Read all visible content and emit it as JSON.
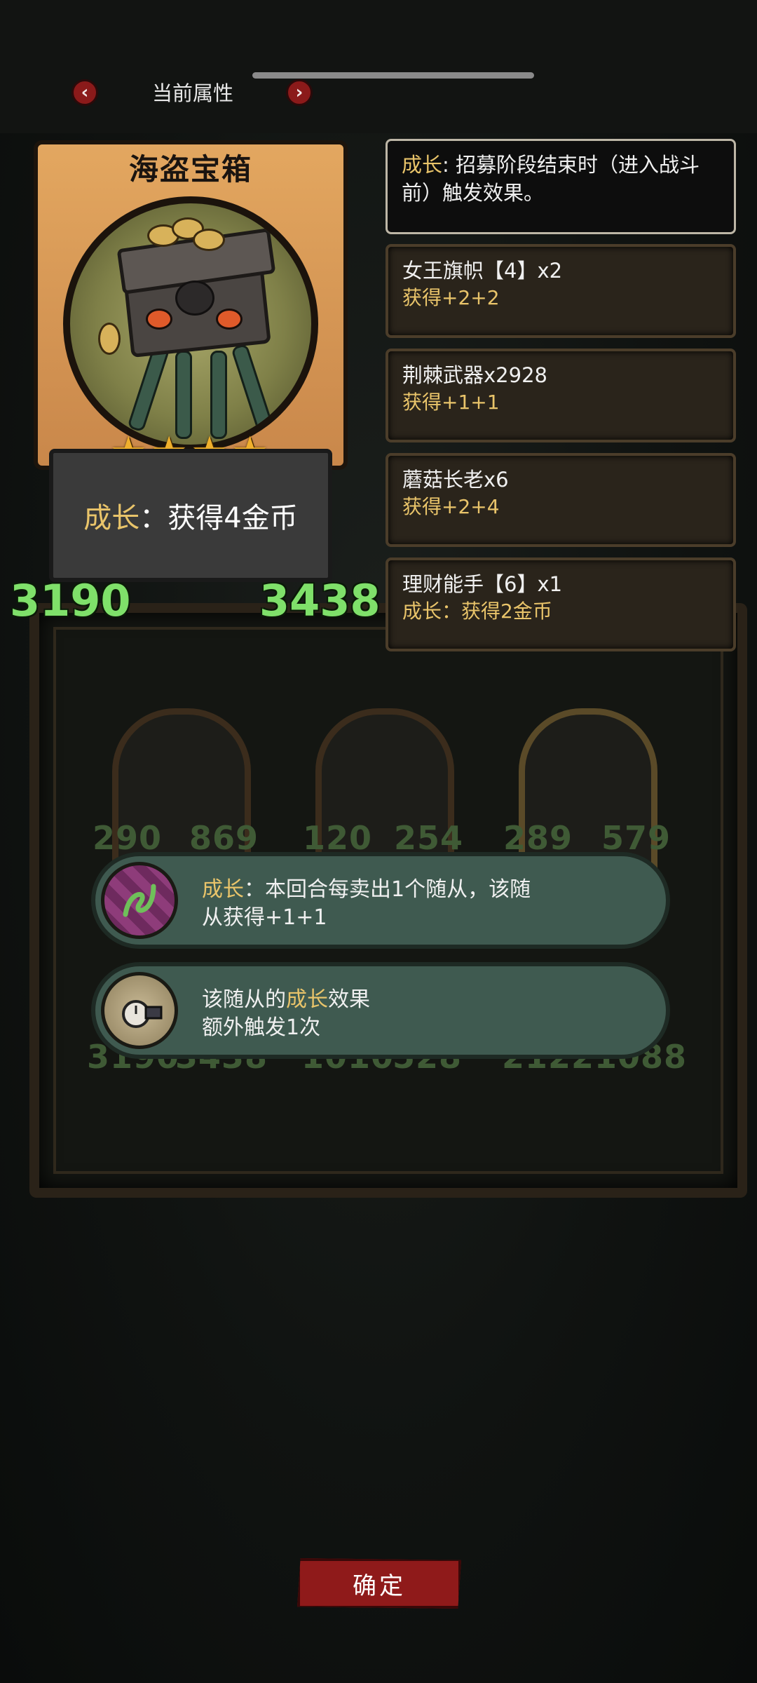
{
  "header": {
    "title": "当前属性",
    "prev_symbol": "‹",
    "next_symbol": "›"
  },
  "minion": {
    "name": "海盗宝箱",
    "stars": "★★★★",
    "star_count": 4,
    "effect_keyword": "成长",
    "effect_text": "：获得4金币",
    "attack": "3190",
    "health": "3438"
  },
  "info": {
    "keyword": "成长",
    "text": ": 招募阶段结束时（进入战斗前）触发效果。"
  },
  "sources": [
    {
      "name": "女王旗帜【4】x2",
      "effect": "获得+2+2"
    },
    {
      "name": "荆棘武器x2928",
      "effect": "获得+1+1"
    },
    {
      "name": "蘑菇长老x6",
      "effect": "获得+2+4"
    },
    {
      "name": "理财能手【6】x1",
      "effect": "成长：获得2金币"
    }
  ],
  "enchantments": [
    {
      "icon": "vine-emblem-icon",
      "keyword": "成长",
      "text_after": "：本回合每卖出1个随从，该随",
      "line2": "从获得+1+1"
    },
    {
      "icon": "stopwatch-gauntlet-icon",
      "prefix": "该随从的",
      "keyword": "成长",
      "suffix": "效果",
      "line2": "额外触发1次"
    }
  ],
  "background": {
    "cards": [
      {
        "attack": "290",
        "health": "869"
      },
      {
        "attack": "120",
        "health": "254"
      },
      {
        "attack": "289",
        "health": "579"
      }
    ],
    "bottom_stats": [
      "3190",
      "3438",
      "1010",
      "528",
      "2122",
      "1088"
    ]
  },
  "confirm_label": "确定",
  "colors": {
    "keyword": "#e9c46a",
    "stat_green": "#7fe06a",
    "confirm_red": "#8f1a1a",
    "pill_teal": "#3f5a50"
  }
}
